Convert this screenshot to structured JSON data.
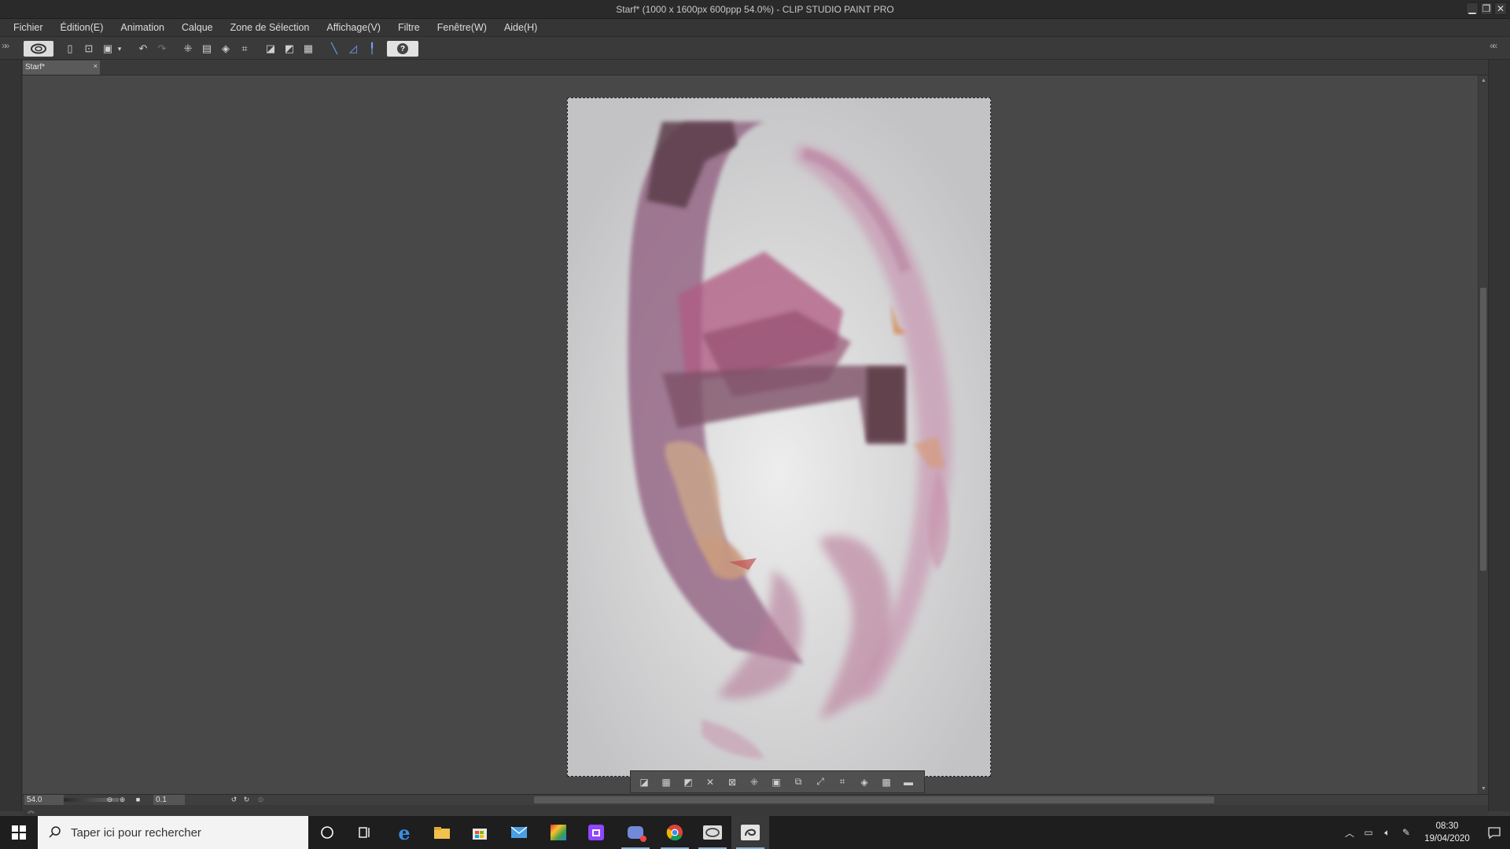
{
  "window": {
    "title": "Starf* (1000 x 1600px 600ppp 54.0%)  - CLIP STUDIO PAINT PRO",
    "controls": [
      "minimize-icon",
      "restore-icon",
      "close-icon"
    ]
  },
  "menu": {
    "items": [
      "Fichier",
      "Édition(E)",
      "Animation",
      "Calque",
      "Zone de Sélection",
      "Affichage(V)",
      "Filtre",
      "Fenêtre(W)",
      "Aide(H)"
    ]
  },
  "toolbar": {
    "icons": [
      "clip-studio-logo-icon",
      "new-file-icon",
      "open-file-icon",
      "save-icon",
      "dropdown-icon",
      "undo-icon",
      "redo-icon",
      "clear-selection-icon",
      "fill-icon",
      "eraser-icon",
      "transform-icon",
      "hide-selection-icon",
      "crop-icon",
      "select-all-icon",
      "snap-ruler-icon",
      "snap-special-ruler-icon",
      "snap-grid-icon",
      "help-icon"
    ]
  },
  "document": {
    "tab_label": "Starf*",
    "tab_close": "×"
  },
  "canvas_tools": {
    "icons": [
      "deselect-icon",
      "select-all-icon",
      "invert-icon",
      "clear-outside-icon",
      "clear-icon",
      "crop-selection-icon",
      "fill-selection-icon",
      "transform-selection-icon",
      "expand-icon",
      "shrink-icon",
      "scale-icon",
      "new-layer-selection-icon",
      "checker-icon",
      "collapse-icon"
    ]
  },
  "status": {
    "zoom": "54.0",
    "angle": "0.1"
  },
  "taskbar": {
    "search_placeholder": "Taper ici pour rechercher",
    "apps": [
      "cortana-icon",
      "task-view-icon",
      "edge-icon",
      "file-explorer-icon",
      "store-icon",
      "mail-icon",
      "color-app-icon",
      "twitch-icon",
      "discord-icon",
      "chrome-icon",
      "clip-studio-icon",
      "clip-studio-paint-icon"
    ],
    "time": "08:30",
    "date": "19/04/2020"
  }
}
